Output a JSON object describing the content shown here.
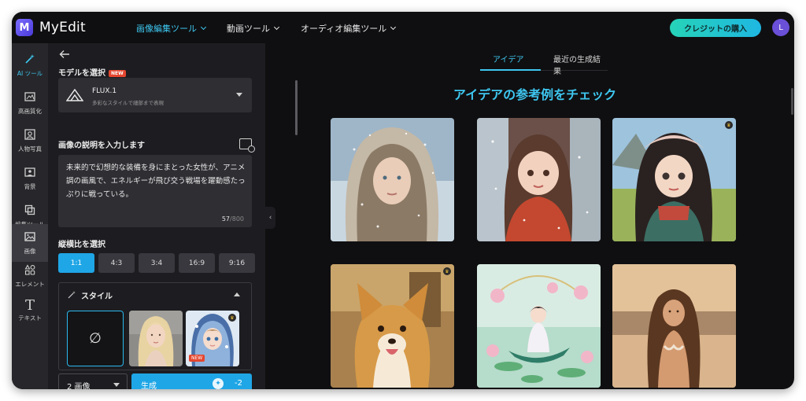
{
  "app": {
    "name": "MyEdit",
    "logo_letter": "M",
    "nav": [
      {
        "label": "画像編集ツール",
        "active": true
      },
      {
        "label": "動画ツール",
        "active": false
      },
      {
        "label": "オーディオ編集ツール",
        "active": false
      }
    ],
    "credit_button": "クレジットの購入",
    "avatar_initial": "L",
    "accent": "#3ec7f0"
  },
  "rail": [
    {
      "label": "AI ツール",
      "icon": "magic-wand-icon",
      "active": true
    },
    {
      "label": "高画質化",
      "icon": "enhance-icon"
    },
    {
      "label": "人物写真",
      "icon": "portrait-icon"
    },
    {
      "label": "背景",
      "icon": "background-icon"
    },
    {
      "label": "編集ツール",
      "icon": "crop-icon"
    },
    {
      "label": "画像",
      "icon": "image-icon",
      "selected": true
    },
    {
      "label": "エレメント",
      "icon": "elements-icon"
    },
    {
      "label": "テキスト",
      "icon": "text-icon"
    }
  ],
  "panel": {
    "model_label": "モデルを選択",
    "new_badge": "NEW",
    "model": {
      "name": "FLUX.1",
      "description": "多彩なスタイルで細部まで表現"
    },
    "prompt_label": "画像の説明を入力します",
    "prompt_text": "未来的で幻想的な装備を身にまとった女性が、アニメ調の画風で、エネルギーが飛び交う戦場を躍動感たっぷりに戦っている。",
    "char_count": "57",
    "char_max": "/800",
    "ratio_label": "縦横比を選択",
    "ratios": [
      "1:1",
      "4:3",
      "3:4",
      "16:9",
      "9:16"
    ],
    "selected_ratio": "1:1",
    "style_label": "スタイル",
    "style_none_symbol": "∅",
    "style_new_badge": "NEW",
    "count_select": "2 画像",
    "generate_label": "生成",
    "credit_cost": "-2"
  },
  "main": {
    "tabs": [
      "アイデア",
      "最近の生成結果"
    ],
    "active_tab": "アイデア",
    "heading": "アイデアの参考例をチェック",
    "gallery": [
      {
        "name": "snow-hood-woman",
        "premium": false
      },
      {
        "name": "winter-anime-girl",
        "premium": false
      },
      {
        "name": "folk-anime-girl",
        "premium": true
      },
      {
        "name": "corgi-painting",
        "premium": true
      },
      {
        "name": "lotus-boat-girl",
        "premium": false
      },
      {
        "name": "beach-woman",
        "premium": false
      }
    ]
  }
}
